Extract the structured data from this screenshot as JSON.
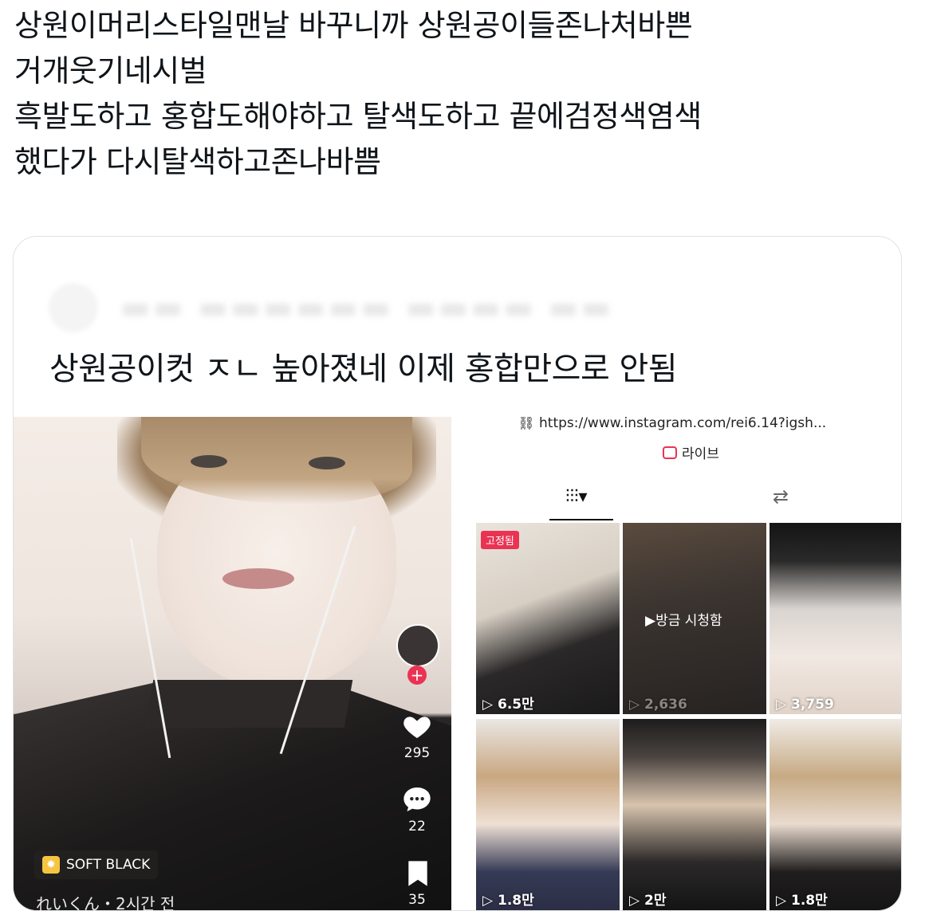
{
  "tweet": {
    "lines": [
      "상원이머리스타일맨날 바꾸니까 상원공이들존나처바쁜",
      "거개웃기네시벌",
      "흑발도하고 홍합도해야하고 탈색도하고 끝에검정색염색",
      "했다가 다시탈색하고존나바쁨"
    ]
  },
  "quote": {
    "text": "상원공이컷 ㅈㄴ 높아졌네 이제 홍합만으로 안됨"
  },
  "left_video": {
    "likes": "295",
    "comments": "22",
    "saves": "35",
    "sound_label": "SOFT BLACK",
    "username_caption": "れいくん・2시간 전"
  },
  "profile_grid": {
    "url": "https://www.instagram.com/rei6.14?igsh...",
    "live_label": "라이브",
    "pinned_label": "고정됨",
    "watched_label": "▶방금 시청함",
    "cells": [
      {
        "views": "6.5만"
      },
      {
        "views": "2,636"
      },
      {
        "views": "3,759"
      },
      {
        "views": "1.8만"
      },
      {
        "views": "2만"
      },
      {
        "views": "1.8만"
      }
    ]
  },
  "colors": {
    "accent_red": "#ea3353",
    "text": "#0f1419",
    "border": "#dfe3e6"
  }
}
